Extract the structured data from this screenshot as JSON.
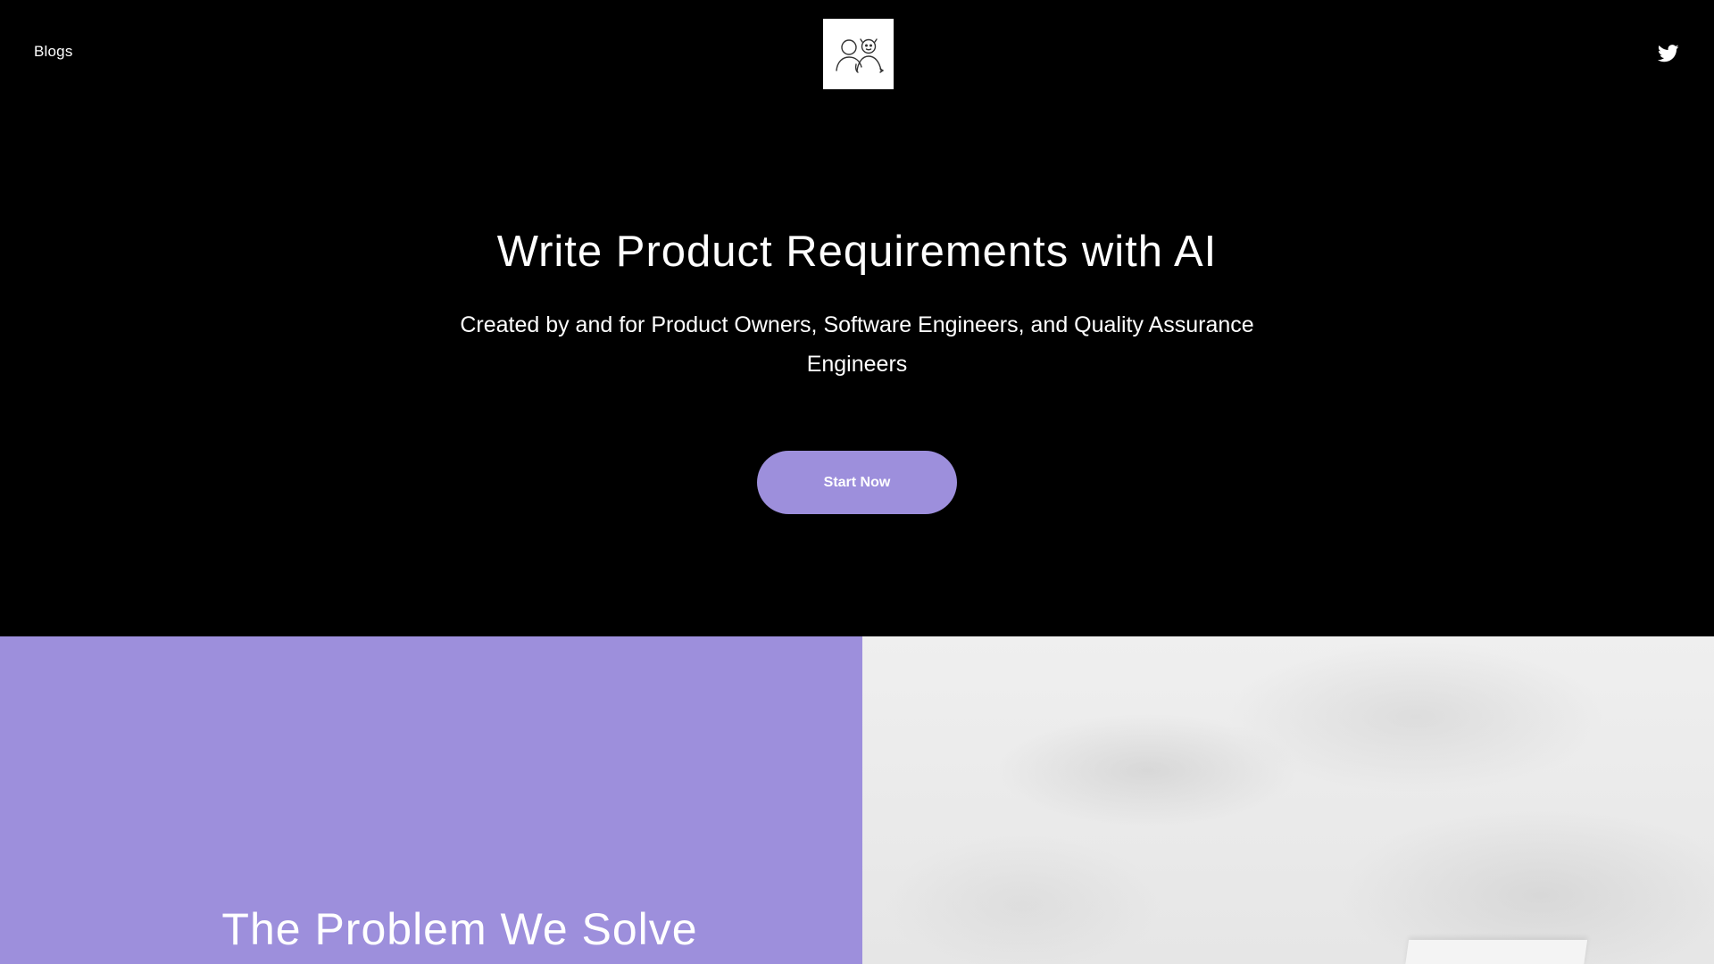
{
  "header": {
    "nav_blogs": "Blogs",
    "logo_icon": "people-sketch-logo",
    "social_icon": "twitter-icon"
  },
  "hero": {
    "title": "Write Product Requirements with AI",
    "subtitle": "Created by and for Product Owners, Software Engineers, and Quality Assurance Engineers",
    "cta_label": "Start Now"
  },
  "problem": {
    "title": "The Problem We Solve"
  },
  "colors": {
    "background": "#000000",
    "accent": "#9d8fdc",
    "text": "#ffffff"
  }
}
